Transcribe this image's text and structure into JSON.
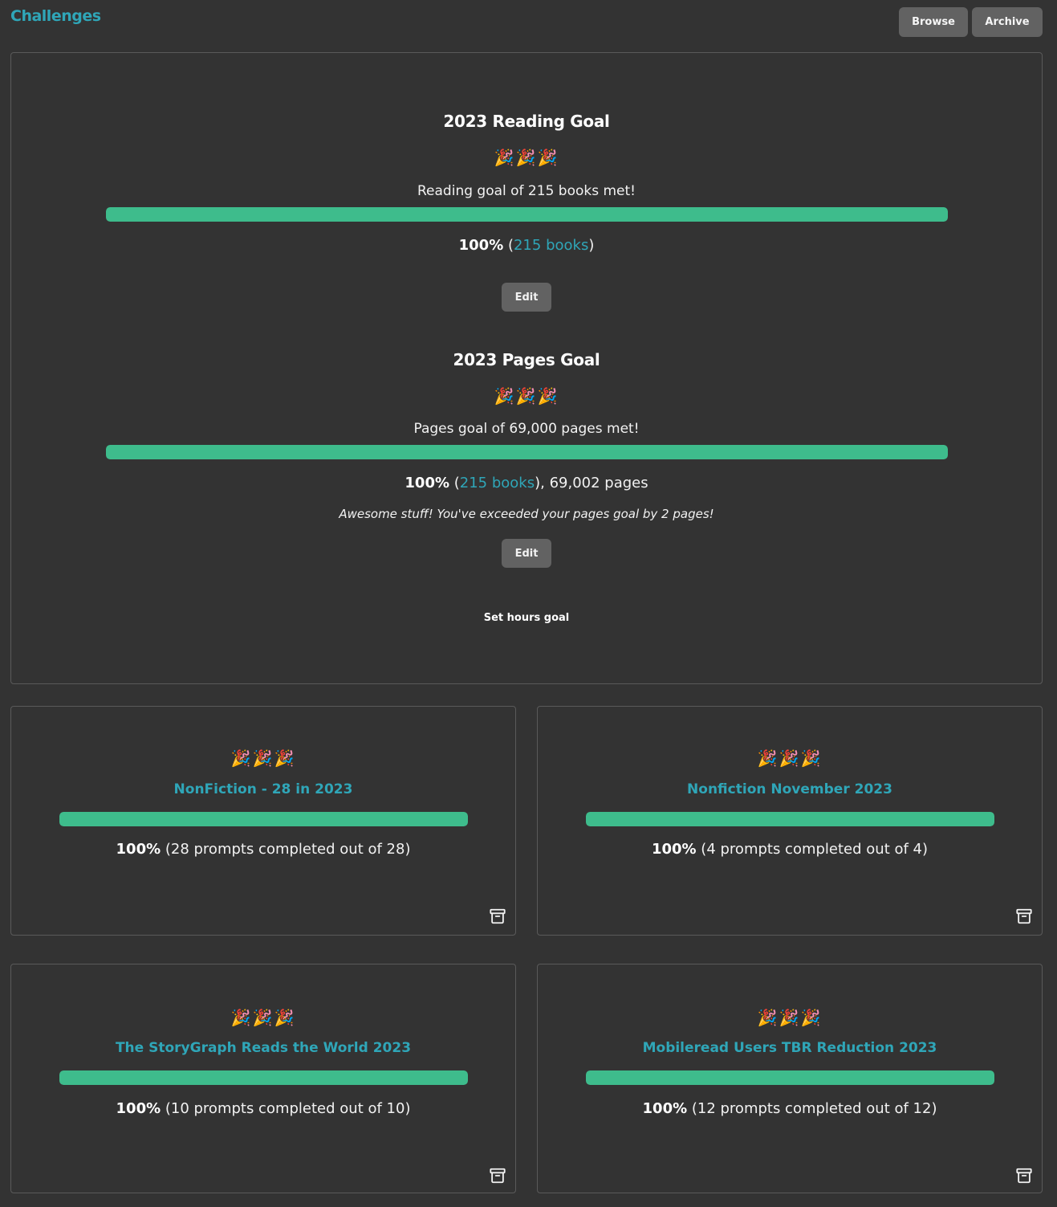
{
  "header": {
    "title": "Challenges",
    "browse_label": "Browse",
    "archive_label": "Archive"
  },
  "colors": {
    "accent": "#2fa6b8",
    "progress": "#3ebc8c",
    "background": "#333333",
    "button": "#626262"
  },
  "reading_goal": {
    "title": "2023 Reading Goal",
    "celebration": "🎉🎉🎉",
    "message": "Reading goal of 215 books met!",
    "progress": 1.0,
    "percent": "100%",
    "books_link": "215 books",
    "edit_label": "Edit"
  },
  "pages_goal": {
    "title": "2023 Pages Goal",
    "celebration": "🎉🎉🎉",
    "message": "Pages goal of 69,000 pages met!",
    "progress": 1.0,
    "percent": "100%",
    "books_link": "215 books",
    "pages_text": ", 69,002 pages",
    "note": "Awesome stuff! You've exceeded your pages goal by 2 pages!",
    "edit_label": "Edit"
  },
  "hours_goal": {
    "set_label": "Set hours goal"
  },
  "challenges": [
    {
      "celebration": "🎉🎉🎉",
      "title": "NonFiction - 28 in 2023",
      "progress": 1.0,
      "percent": "100%",
      "detail": " (28 prompts completed out of 28)",
      "icon": "archive-icon"
    },
    {
      "celebration": "🎉🎉🎉",
      "title": "Nonfiction November 2023",
      "progress": 1.0,
      "percent": "100%",
      "detail": " (4 prompts completed out of 4)",
      "icon": "archive-icon"
    },
    {
      "celebration": "🎉🎉🎉",
      "title": "The StoryGraph Reads the World 2023",
      "progress": 1.0,
      "percent": "100%",
      "detail": " (10 prompts completed out of 10)",
      "icon": "archive-icon"
    },
    {
      "celebration": "🎉🎉🎉",
      "title": "Mobileread Users TBR Reduction 2023",
      "progress": 1.0,
      "percent": "100%",
      "detail": " (12 prompts completed out of 12)",
      "icon": "archive-icon"
    }
  ]
}
